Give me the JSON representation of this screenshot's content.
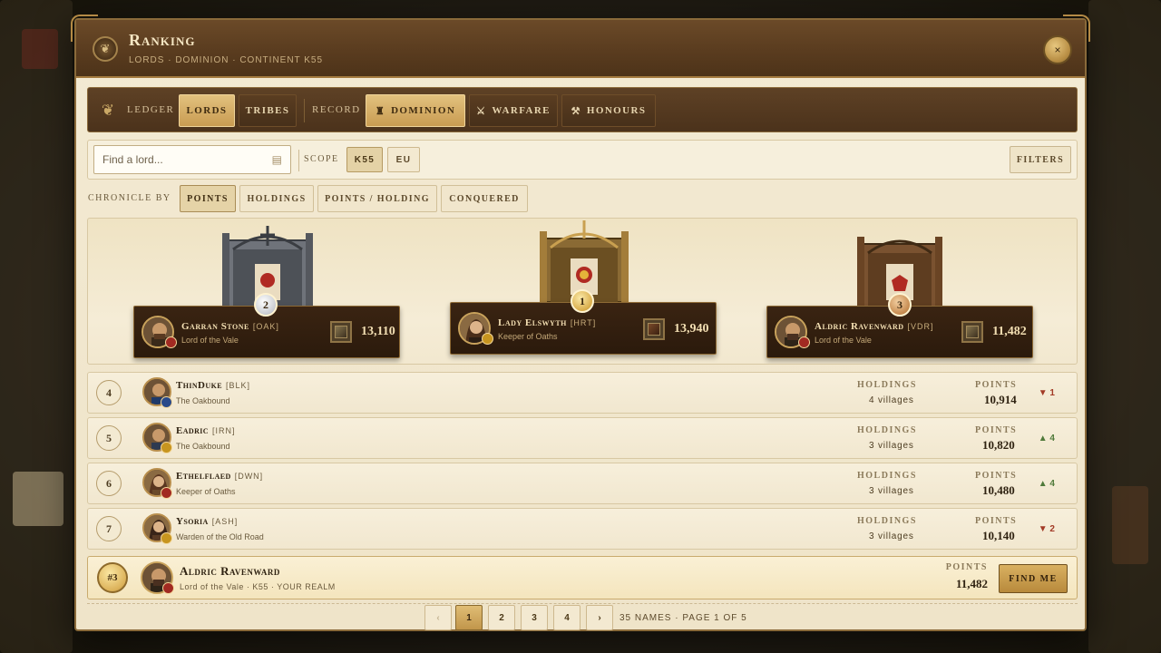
{
  "window": {
    "title": "Ranking",
    "subtitle": "LORDS · DOMINION · CONTINENT K55",
    "close_label": "×"
  },
  "tabbar": {
    "ledger_label": "LEDGER",
    "ledger_tabs": [
      {
        "label": "LORDS",
        "active": true
      },
      {
        "label": "TRIBES",
        "active": false
      }
    ],
    "record_label": "RECORD",
    "record_tabs": [
      {
        "label": "DOMINION",
        "icon": "tower-icon",
        "active": true
      },
      {
        "label": "WARFARE",
        "icon": "crossed-swords-icon",
        "active": false
      },
      {
        "label": "HONOURS",
        "icon": "hammer-icon",
        "active": false
      }
    ]
  },
  "filterbar": {
    "search_placeholder": "Find a lord...",
    "scope_label": "SCOPE",
    "scopes": [
      {
        "label": "K55",
        "active": true
      },
      {
        "label": "EU",
        "active": false
      }
    ],
    "filters_label": "FILTERS"
  },
  "chronicle": {
    "label": "CHRONICLE BY",
    "options": [
      {
        "label": "POINTS",
        "active": true
      },
      {
        "label": "HOLDINGS",
        "active": false
      },
      {
        "label": "POINTS / HOLDING",
        "active": false
      },
      {
        "label": "CONQUERED",
        "active": false
      }
    ]
  },
  "podium": [
    {
      "rank": "2",
      "name": "Garran Stone",
      "tag": "[OAK]",
      "title": "Lord of the Vale",
      "points": "13,110",
      "medal": "silver",
      "crest_color": "#a12a22"
    },
    {
      "rank": "1",
      "name": "Lady Elswyth",
      "tag": "[HRT]",
      "title": "Keeper of Oaths",
      "points": "13,940",
      "medal": "gold",
      "crest_color": "#c7951f"
    },
    {
      "rank": "3",
      "name": "Aldric Ravenward",
      "tag": "[VDR]",
      "title": "Lord of the Vale",
      "points": "11,482",
      "medal": "bronze",
      "crest_color": "#a12a22"
    }
  ],
  "table": {
    "holdings_header": "HOLDINGS",
    "points_header": "POINTS",
    "rows": [
      {
        "rank": "4",
        "name": "ThinDuke",
        "tag": "[BLK]",
        "title": "The Oakbound",
        "holdings": "4 villages",
        "points": "10,914",
        "delta": "▼ 1",
        "trend": "down",
        "crest_color": "#2a4a8a"
      },
      {
        "rank": "5",
        "name": "Eadric",
        "tag": "[IRN]",
        "title": "The Oakbound",
        "holdings": "3 villages",
        "points": "10,820",
        "delta": "▲ 4",
        "trend": "up",
        "crest_color": "#c7951f"
      },
      {
        "rank": "6",
        "name": "Ethelflaed",
        "tag": "[DWN]",
        "title": "Keeper of Oaths",
        "holdings": "3 villages",
        "points": "10,480",
        "delta": "▲ 4",
        "trend": "up",
        "crest_color": "#a12a22"
      },
      {
        "rank": "7",
        "name": "Ysoria",
        "tag": "[ASH]",
        "title": "Warden of the Old Road",
        "holdings": "3 villages",
        "points": "10,140",
        "delta": "▼ 2",
        "trend": "down",
        "crest_color": "#c7951f"
      }
    ]
  },
  "you": {
    "rank": "#3",
    "name": "Aldric Ravenward",
    "subtitle": "Lord of the Vale · K55 · YOUR REALM",
    "points_header": "POINTS",
    "points": "11,482",
    "find_label": "FIND ME"
  },
  "pager": {
    "prev": "‹",
    "pages": [
      "1",
      "2",
      "3",
      "4"
    ],
    "next": "›",
    "info": "35 NAMES · PAGE 1 OF 5"
  }
}
